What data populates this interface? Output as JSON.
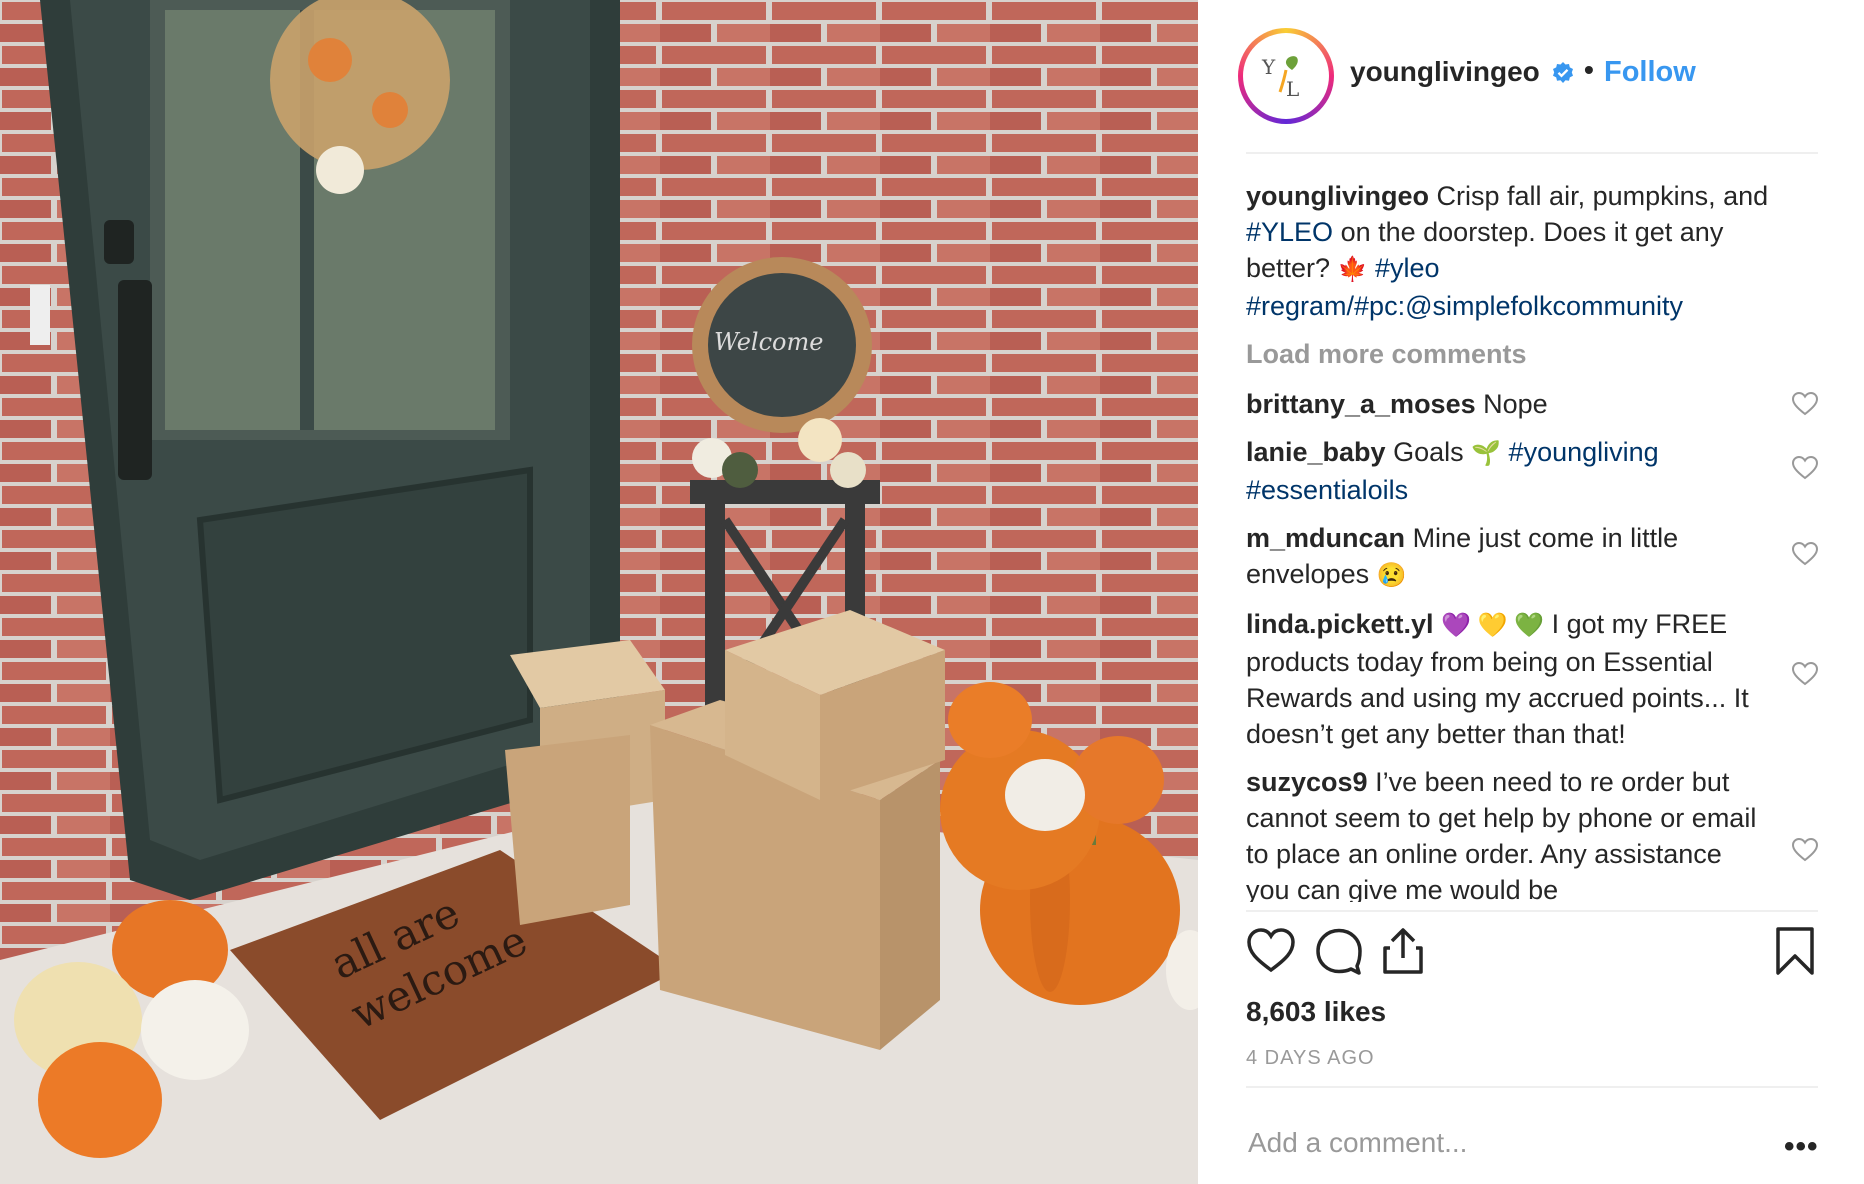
{
  "colors": {
    "link": "#003569",
    "accent": "#3897f0",
    "muted": "#999999",
    "text": "#262626"
  },
  "photo": {
    "icon": "photo-porch-pumpkins-packages"
  },
  "header": {
    "avatar_icon": "young-living-logo-icon",
    "username": "younglivingeo",
    "verified_icon": "verified-badge-icon",
    "separator": "•",
    "follow_label": "Follow"
  },
  "caption": {
    "username": "younglivingeo",
    "text1": "Crisp fall air, pumpkins, and",
    "tag1": "#YLEO",
    "text2": "on the doorstep. Does it get any better?",
    "emoji": "🍁",
    "tag2": "#yleo",
    "tag3": "#regram/#pc:@simplefolkcommunity"
  },
  "load_more": "Load more comments",
  "comments": [
    {
      "username": "brittany_a_moses",
      "text": "Nope",
      "tags": "",
      "emoji": ""
    },
    {
      "username": "lanie_baby",
      "text": "Goals",
      "emoji": "🌱",
      "tags": "#youngliving #essentialoils"
    },
    {
      "username": "m_mduncan",
      "text": "Mine just come in little envelopes",
      "emoji": "😢",
      "tags": ""
    },
    {
      "username": "linda.pickett.yl",
      "emoji": "💜 💛 💚",
      "text": "I got my FREE products today from being on Essential Rewards and using my accrued points... It doesn’t get any better than that!",
      "tags": ""
    },
    {
      "username": "suzycos9",
      "text": "I’ve been need to re order but cannot seem to get help by phone or email to place an online order. Any assistance you can give me would be",
      "emoji": "",
      "tags": ""
    }
  ],
  "actions": {
    "like_icon": "heart-icon",
    "comment_icon": "comment-icon",
    "share_icon": "share-icon",
    "save_icon": "bookmark-icon"
  },
  "likes": "8,603 likes",
  "date": "4 DAYS AGO",
  "add_comment_placeholder": "Add a comment...",
  "more_label": "•••"
}
